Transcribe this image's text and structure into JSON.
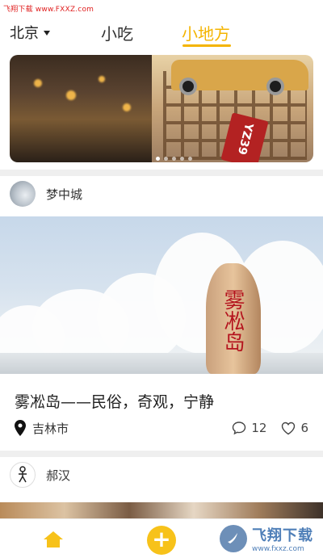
{
  "watermark": "飞翔下载 www.FXXZ.com",
  "header": {
    "city": "北京",
    "tabs": [
      {
        "label": "小吃",
        "active": false
      },
      {
        "label": "小地方",
        "active": true
      }
    ],
    "accent_color": "#f4b400"
  },
  "banner": {
    "plate_text": "YZ39",
    "page_indicator_count": 5
  },
  "cards": [
    {
      "author": "梦中城",
      "stone_text": "雾凇岛",
      "title": "雾凇岛——民俗，奇观，宁静",
      "location": "吉林市",
      "comments": "12",
      "likes": "6"
    },
    {
      "author": "郝汉"
    }
  ],
  "bottom_nav": {
    "items": [
      {
        "icon": "home-icon"
      },
      {
        "icon": "plus-icon"
      }
    ],
    "logo_text": "飞翔下载",
    "logo_sub": "www.fxxz.com"
  }
}
